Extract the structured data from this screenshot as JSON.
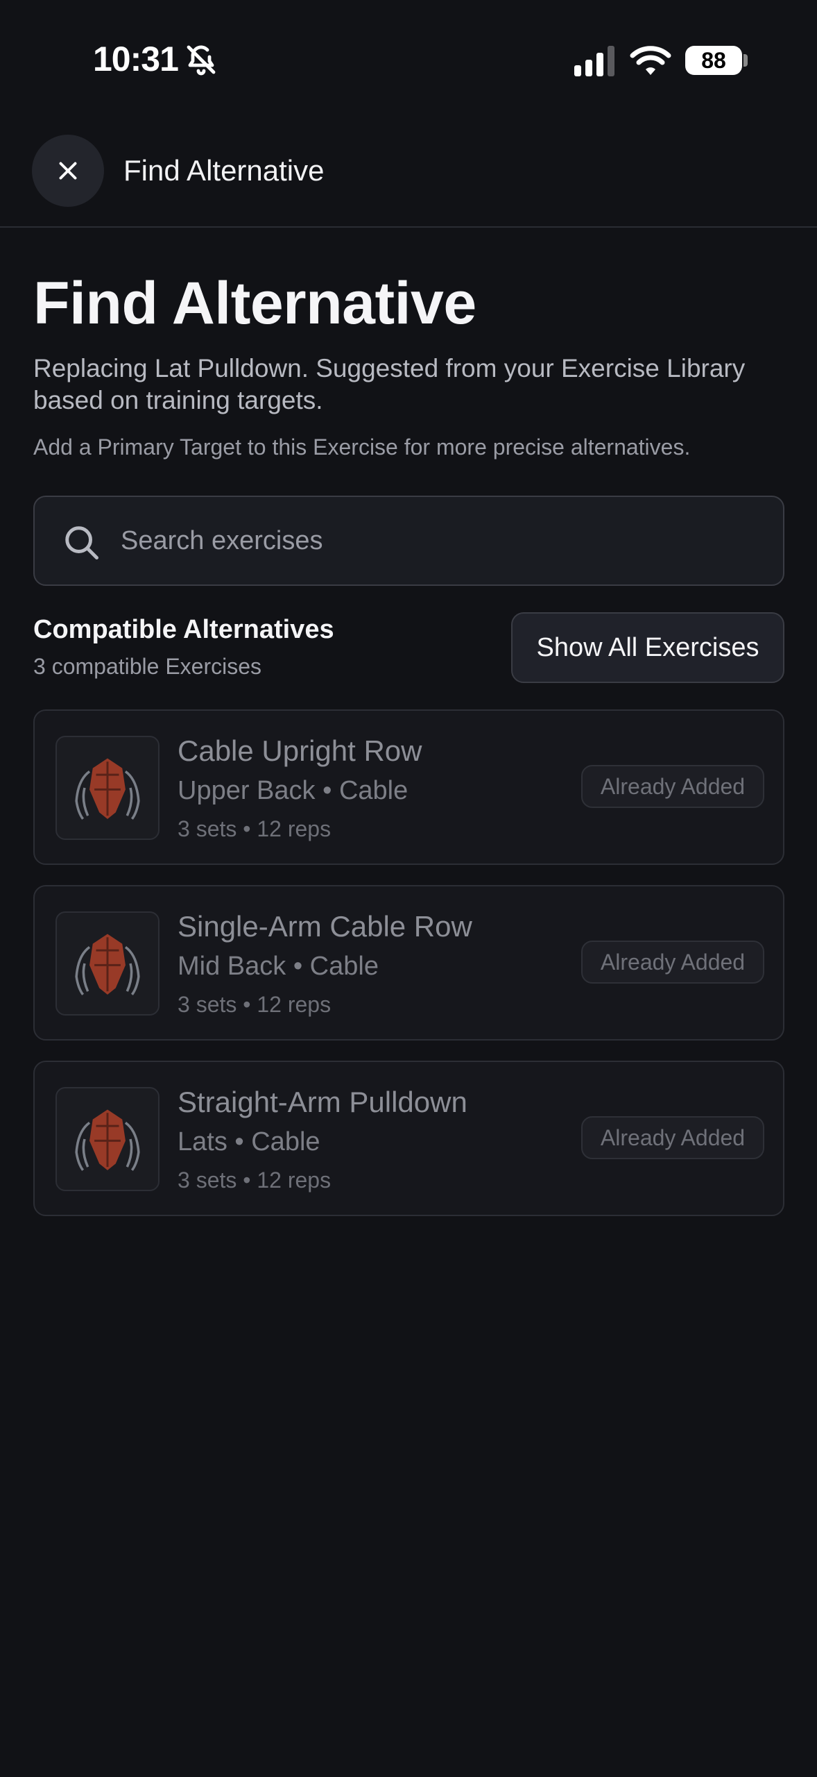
{
  "status_bar": {
    "time": "10:31",
    "battery": "88"
  },
  "header": {
    "title": "Find Alternative"
  },
  "page": {
    "title": "Find Alternative",
    "subtitle": "Replacing Lat Pulldown. Suggested from your Exercise Library based on training targets.",
    "hint": "Add a Primary Target to this Exercise for more precise alternatives."
  },
  "search": {
    "placeholder": "Search exercises",
    "value": ""
  },
  "section": {
    "title": "Compatible Alternatives",
    "count": "3 compatible Exercises",
    "show_all_label": "Show All Exercises"
  },
  "exercises": [
    {
      "name": "Cable Upright Row",
      "meta": "Upper Back • Cable",
      "sets": "3 sets • 12 reps",
      "badge": "Already Added"
    },
    {
      "name": "Single-Arm Cable Row",
      "meta": "Mid Back • Cable",
      "sets": "3 sets • 12 reps",
      "badge": "Already Added"
    },
    {
      "name": "Straight-Arm Pulldown",
      "meta": "Lats • Cable",
      "sets": "3 sets • 12 reps",
      "badge": "Already Added"
    }
  ],
  "colors": {
    "background": "#111216",
    "muscle_highlight": "#c2452a"
  },
  "icons": [
    "bell-slash-icon",
    "signal-icon",
    "wifi-icon",
    "close-icon",
    "search-icon",
    "back-muscle-icon"
  ]
}
